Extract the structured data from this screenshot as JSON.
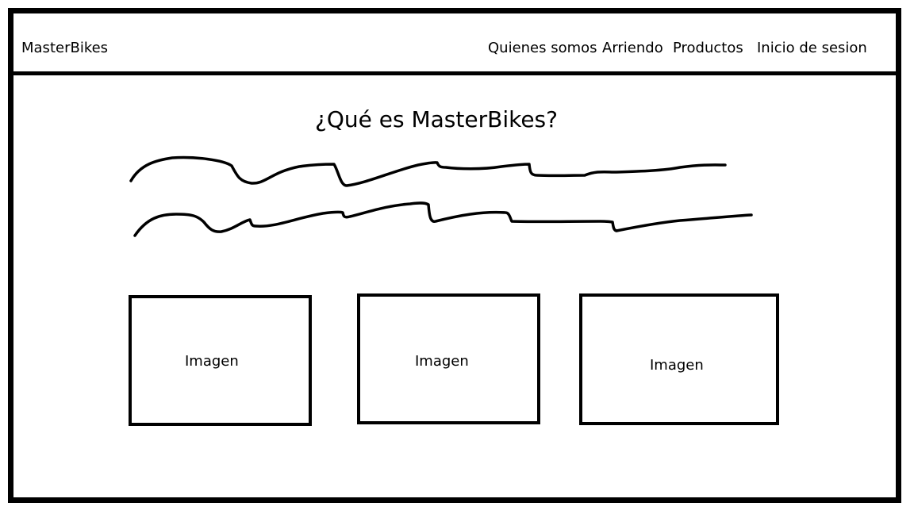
{
  "header": {
    "brand": "MasterBikes",
    "nav": [
      {
        "label": "Quienes somos"
      },
      {
        "label": "Arriendo"
      },
      {
        "label": "Productos"
      },
      {
        "label": "Inicio de sesion"
      }
    ]
  },
  "main": {
    "title": "¿Qué es MasterBikes?",
    "placeholder_text_lines": 2,
    "images": [
      {
        "label": "Imagen"
      },
      {
        "label": "Imagen"
      },
      {
        "label": "Imagen"
      }
    ]
  },
  "colors": {
    "ink": "#000000",
    "background": "#ffffff"
  }
}
